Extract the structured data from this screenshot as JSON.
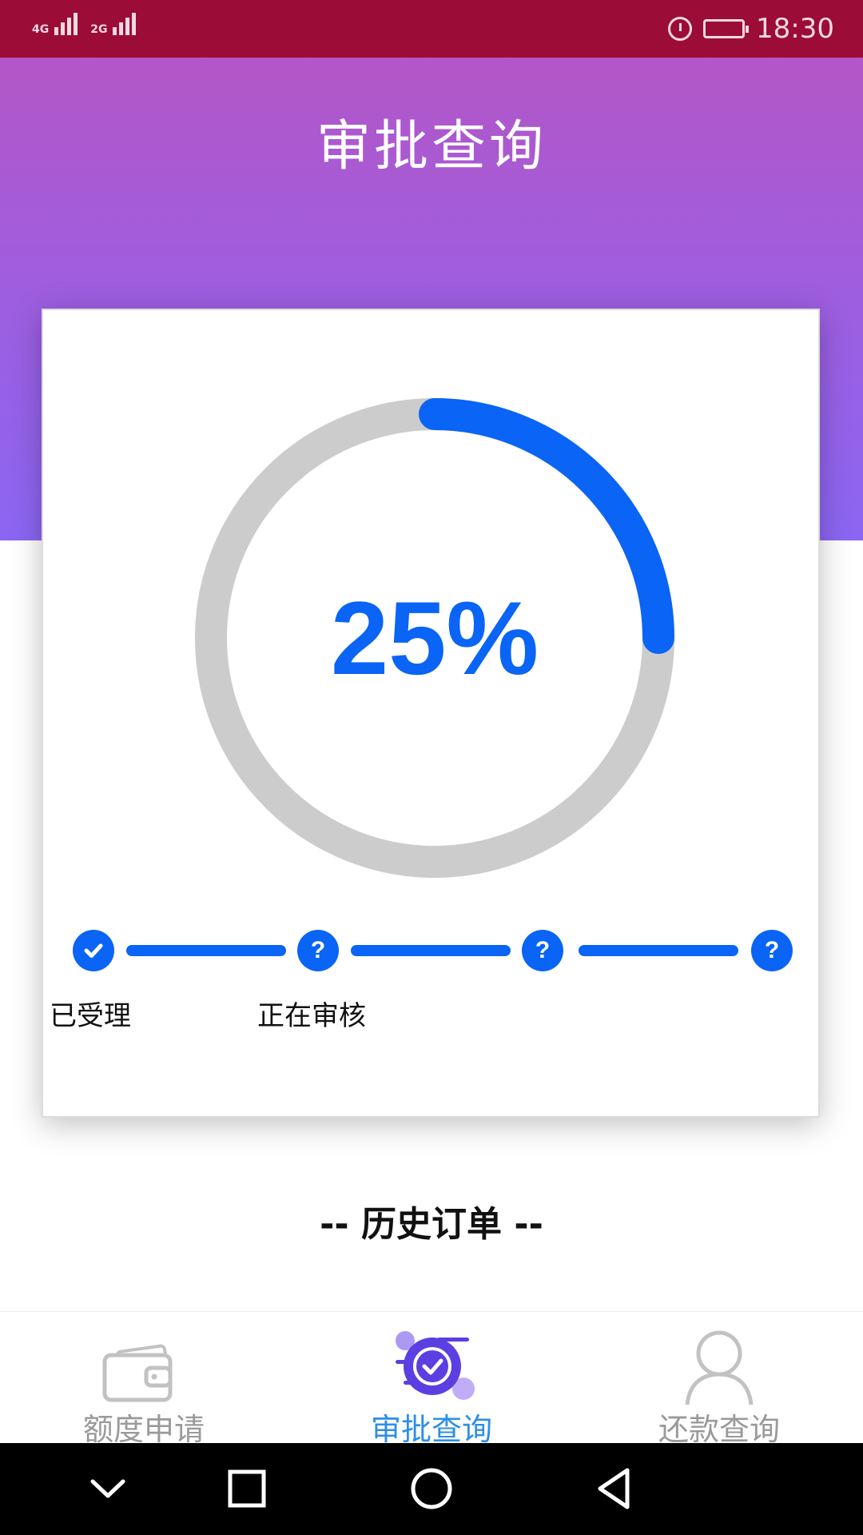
{
  "status_bar": {
    "network_1": "4G",
    "network_2": "2G",
    "time": "18:30",
    "icons": [
      "signal-icon",
      "alarm-icon",
      "battery-charging-icon"
    ]
  },
  "header": {
    "title": "审批查询"
  },
  "progress": {
    "percent_label": "25%",
    "value": 0.25,
    "track_color": "#cccccc",
    "fill_color": "#0a64f5"
  },
  "steps": [
    {
      "label": "已受理",
      "state": "done",
      "icon": "check-icon"
    },
    {
      "label": "正在审核",
      "state": "pending",
      "icon": "?"
    },
    {
      "label": "",
      "state": "pending",
      "icon": "?"
    },
    {
      "label": "",
      "state": "pending",
      "icon": "?"
    }
  ],
  "history": {
    "title": "-- 历史订单 --"
  },
  "tabs": [
    {
      "label": "额度申请",
      "icon": "wallet-icon",
      "active": false
    },
    {
      "label": "审批查询",
      "icon": "approval-check-icon",
      "active": true
    },
    {
      "label": "还款查询",
      "icon": "user-icon",
      "active": false
    }
  ],
  "colors": {
    "status_bar": "#9b0c36",
    "header_top": "#b356c7",
    "header_bottom": "#8b66f2",
    "accent": "#0a64f5",
    "tab_active": "#2d8fe6",
    "tab_inactive": "#9a9a9a"
  },
  "nav_bar": {
    "buttons": [
      "chevron-down-icon",
      "recents-icon",
      "home-icon",
      "back-icon"
    ]
  }
}
